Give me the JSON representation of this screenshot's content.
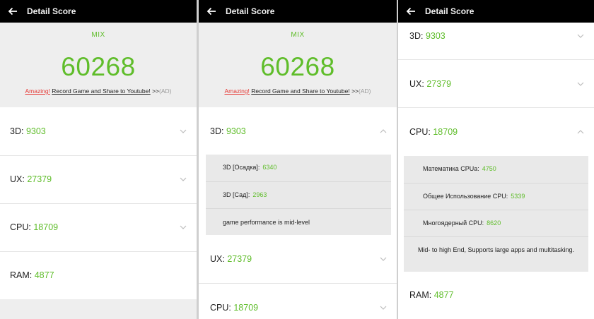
{
  "header": {
    "title": "Detail Score"
  },
  "hero": {
    "mode": "MIX",
    "total": "60268",
    "promo_amazing": "Amazing!",
    "promo_text": "Record Game and Share to Youtube!",
    "promo_arrows": ">>",
    "promo_ad": "(AD)"
  },
  "scores": {
    "d3": {
      "label": "3D:",
      "value": "9303"
    },
    "ux": {
      "label": "UX:",
      "value": "27379"
    },
    "cpu": {
      "label": "CPU:",
      "value": "18709"
    },
    "ram": {
      "label": "RAM:",
      "value": "4877"
    }
  },
  "d3_details": {
    "items": [
      {
        "label": "3D [Осадка]:",
        "value": "6340"
      },
      {
        "label": "3D [Сад]:",
        "value": "2963"
      }
    ],
    "note": "game performance is mid-level"
  },
  "cpu_details": {
    "items": [
      {
        "label": "Математика CPUa:",
        "value": "4750"
      },
      {
        "label": "Общее Использование CPU:",
        "value": "5339"
      },
      {
        "label": "Многоядерный CPU:",
        "value": "8620"
      }
    ],
    "note": "Mid- to high End, Supports large apps and multitasking."
  },
  "colors": {
    "accent": "#5fbd2a",
    "promo_red": "#e53935",
    "bar": "#000000"
  }
}
